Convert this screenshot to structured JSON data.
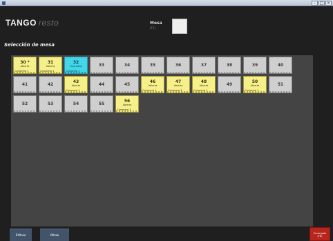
{
  "window": {
    "controls": [
      "minimize-icon",
      "maximize-icon",
      "close-icon"
    ]
  },
  "header": {
    "brand": "TANGO",
    "product": "resto",
    "mesa_label": "Mesa",
    "mesa_sub": "(F1)",
    "mesa_value": ""
  },
  "section_title": "Selección de mesa",
  "tables": [
    {
      "num": "30 *",
      "status": "Abierta",
      "waiter": "Camarero 1",
      "state": "ocupada"
    },
    {
      "num": "31",
      "status": "Abierta",
      "waiter": "Camarero 1",
      "state": "ocupada"
    },
    {
      "num": "32",
      "status": "Facturada",
      "waiter": "Camarero 1",
      "state": "seleccion"
    },
    {
      "num": "33",
      "status": "",
      "waiter": "",
      "state": "libre"
    },
    {
      "num": "34",
      "status": "",
      "waiter": "",
      "state": "libre"
    },
    {
      "num": "35",
      "status": "",
      "waiter": "",
      "state": "libre"
    },
    {
      "num": "36",
      "status": "",
      "waiter": "",
      "state": "libre"
    },
    {
      "num": "37",
      "status": "",
      "waiter": "",
      "state": "libre"
    },
    {
      "num": "38",
      "status": "",
      "waiter": "",
      "state": "libre"
    },
    {
      "num": "39",
      "status": "",
      "waiter": "",
      "state": "libre"
    },
    {
      "num": "40",
      "status": "",
      "waiter": "",
      "state": "libre"
    },
    {
      "num": "41",
      "status": "",
      "waiter": "",
      "state": "libre"
    },
    {
      "num": "42",
      "status": "",
      "waiter": "",
      "state": "libre"
    },
    {
      "num": "43",
      "status": "Abierta",
      "waiter": "Camarero 1",
      "state": "ocupada"
    },
    {
      "num": "44",
      "status": "",
      "waiter": "",
      "state": "libre"
    },
    {
      "num": "45",
      "status": "",
      "waiter": "",
      "state": "libre"
    },
    {
      "num": "46",
      "status": "Abierta",
      "waiter": "Camarero 1",
      "state": "ocupada"
    },
    {
      "num": "47",
      "status": "Abierta",
      "waiter": "Camarero 3",
      "state": "ocupada"
    },
    {
      "num": "48",
      "status": "Abierta",
      "waiter": "Camarero 1",
      "state": "ocupada"
    },
    {
      "num": "49",
      "status": "",
      "waiter": "",
      "state": "libre"
    },
    {
      "num": "50",
      "status": "Abierta",
      "waiter": "Camarero 1",
      "state": "ocupada"
    },
    {
      "num": "51",
      "status": "",
      "waiter": "",
      "state": "libre"
    },
    {
      "num": "52",
      "status": "",
      "waiter": "",
      "state": "libre"
    },
    {
      "num": "53",
      "status": "",
      "waiter": "",
      "state": "libre"
    },
    {
      "num": "54",
      "status": "",
      "waiter": "",
      "state": "libre"
    },
    {
      "num": "55",
      "status": "",
      "waiter": "",
      "state": "libre"
    },
    {
      "num": "56",
      "status": "Abierta",
      "waiter": "Camarero 3",
      "state": "ocupada"
    }
  ],
  "footer": {
    "filtros_label": "Filtros",
    "otras_label": "Otras",
    "right_label_1": "Encargado",
    "right_label_2": "(F8)"
  },
  "colors": {
    "background": "#1f1f1f",
    "panel": "#444444",
    "libre": "#cfcfcf",
    "ocupada": "#f6f08a",
    "seleccion": "#42d6e8",
    "footer_button": "#41546a",
    "exit_button": "#b8251f"
  }
}
